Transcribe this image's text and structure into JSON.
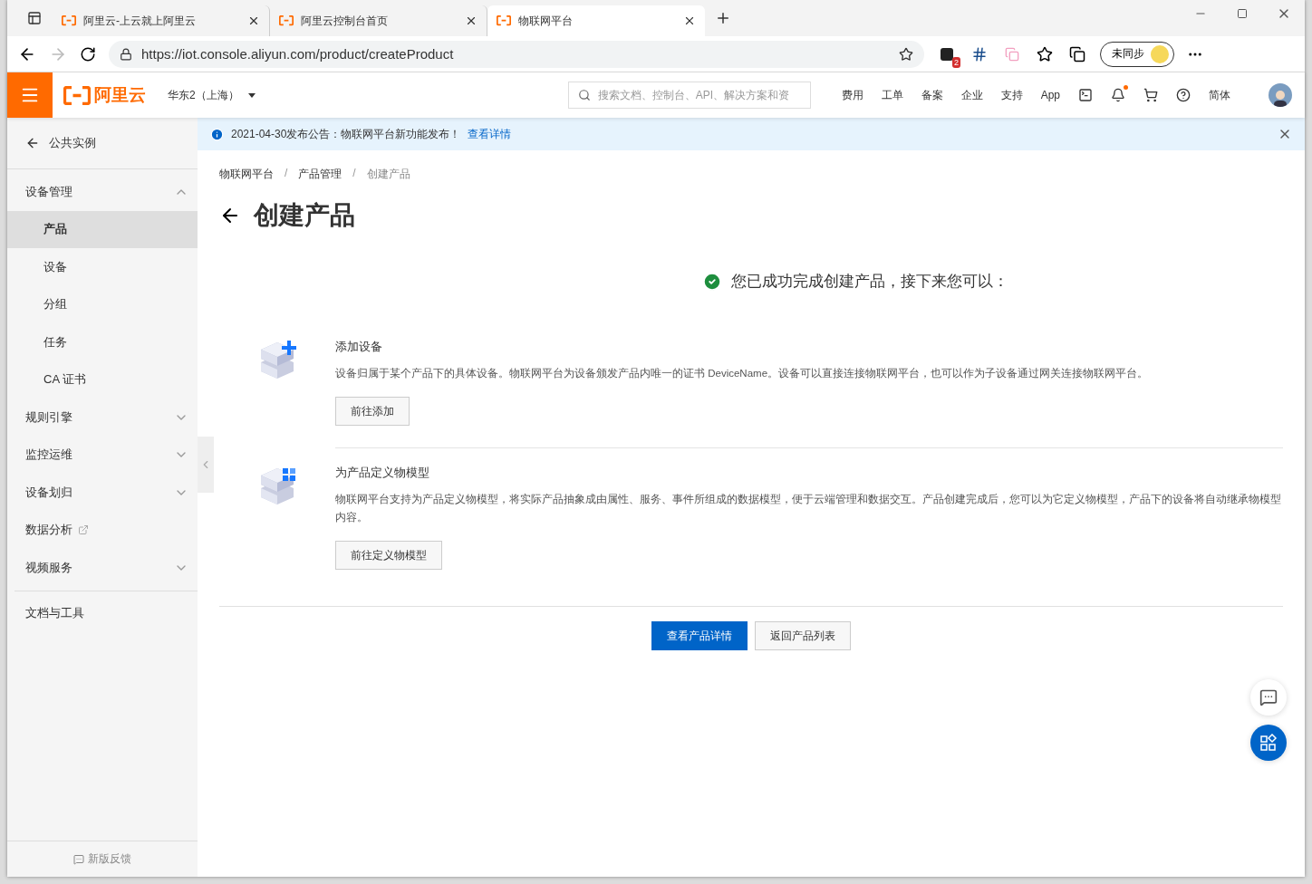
{
  "browser": {
    "tabs": [
      {
        "title": "阿里云-上云就上阿里云",
        "selected": false
      },
      {
        "title": "阿里云控制台首页",
        "selected": false
      },
      {
        "title": "物联网平台",
        "selected": true
      }
    ],
    "url": "https://iot.console.aliyun.com/product/createProduct",
    "extension_badge": "2",
    "sync_label": "未同步"
  },
  "topbar": {
    "logo": "阿里云",
    "region": "华东2（上海）",
    "search_placeholder": "搜索文档、控制台、API、解决方案和资",
    "links": [
      "费用",
      "工单",
      "备案",
      "企业",
      "支持",
      "App"
    ],
    "language": "简体",
    "has_notification": true
  },
  "sidebar": {
    "back_label": "公共实例",
    "items": [
      {
        "kind": "group",
        "label": "设备管理",
        "expanded": true,
        "children": [
          {
            "label": "产品",
            "selected": true
          },
          {
            "label": "设备",
            "selected": false
          },
          {
            "label": "分组",
            "selected": false
          },
          {
            "label": "任务",
            "selected": false
          },
          {
            "label": "CA 证书",
            "selected": false
          }
        ]
      },
      {
        "kind": "group",
        "label": "规则引擎",
        "expanded": false
      },
      {
        "kind": "group",
        "label": "监控运维",
        "expanded": false
      },
      {
        "kind": "group",
        "label": "设备划归",
        "expanded": false
      },
      {
        "kind": "external",
        "label": "数据分析"
      },
      {
        "kind": "group",
        "label": "视频服务",
        "expanded": false
      }
    ],
    "bottom_links": [
      "文档与工具"
    ],
    "feedback": "新版反馈"
  },
  "notice": {
    "text": "2021-04-30发布公告：物联网平台新功能发布！",
    "link": "查看详情"
  },
  "breadcrumb": [
    "物联网平台",
    "产品管理",
    "创建产品"
  ],
  "breadcrumb_separator": "/",
  "page_title": "创建产品",
  "success_message": "您已成功完成创建产品，接下来您可以：",
  "steps": [
    {
      "kind": "add",
      "title": "添加设备",
      "description": "设备归属于某个产品下的具体设备。物联网平台为设备颁发产品内唯一的证书 DeviceName。设备可以直接连接物联网平台，也可以作为子设备通过网关连接物联网平台。",
      "button": "前往添加"
    },
    {
      "kind": "model",
      "title": "为产品定义物模型",
      "description": "物联网平台支持为产品定义物模型，将实际产品抽象成由属性、服务、事件所组成的数据模型，便于云端管理和数据交互。产品创建完成后，您可以为它定义物模型，产品下的设备将自动继承物模型内容。",
      "button": "前往定义物模型"
    }
  ],
  "actions": [
    {
      "kind": "primary",
      "label": "查看产品详情"
    },
    {
      "kind": "secondary",
      "label": "返回产品列表"
    }
  ]
}
